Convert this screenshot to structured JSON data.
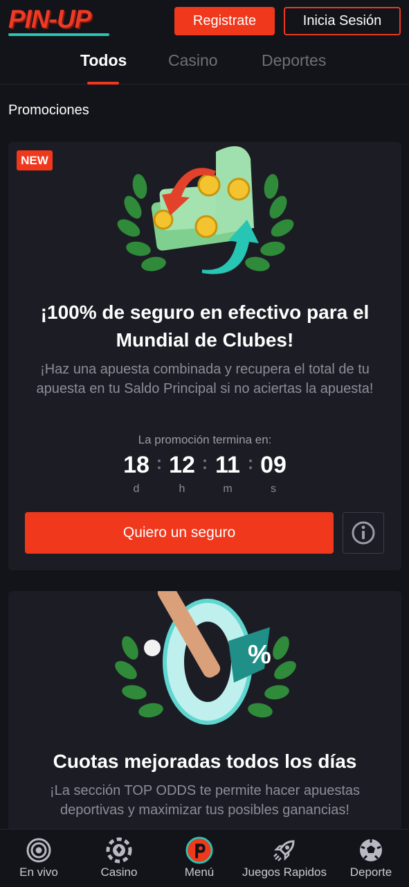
{
  "header": {
    "logo_text": "PIN-UP",
    "register_label": "Registrate",
    "login_label": "Inicia Sesión"
  },
  "tabs": [
    {
      "label": "Todos",
      "active": true
    },
    {
      "label": "Casino",
      "active": false
    },
    {
      "label": "Deportes",
      "active": false
    }
  ],
  "section_title": "Promociones",
  "promos": [
    {
      "badge": "NEW",
      "art_icon": "cashback-money-icon",
      "title_line1": "¡100% de seguro en efectivo para el",
      "title_line2": "Mundial de Clubes!",
      "desc_line1": "¡Haz una apuesta combinada y recupera el total de tu",
      "desc_line2": "apuesta en tu Saldo Principal si no aciertas la apuesta!",
      "countdown_label": "La promoción termina en:",
      "countdown": [
        {
          "value": "18",
          "unit": "d"
        },
        {
          "value": "12",
          "unit": "h"
        },
        {
          "value": "11",
          "unit": "m"
        },
        {
          "value": "09",
          "unit": "s"
        }
      ],
      "cta_label": "Quiero un seguro",
      "info_icon": "info-icon"
    },
    {
      "art_icon": "zero-percent-bat-icon",
      "title_line1": "Cuotas mejoradas todos los días",
      "desc_line1": "¡La sección TOP ODDS te permite hacer apuestas",
      "desc_line2": "deportivas y maximizar tus posibles ganancias!"
    }
  ],
  "bottom_nav": [
    {
      "label": "En vivo",
      "icon": "live-icon"
    },
    {
      "label": "Casino",
      "icon": "casino-chip-icon"
    },
    {
      "label": "Menú",
      "icon": "pinup-logo-icon"
    },
    {
      "label": "Juegos Rapidos",
      "icon": "rocket-icon"
    },
    {
      "label": "Deporte",
      "icon": "soccer-ball-icon"
    }
  ],
  "colors": {
    "accent": "#f0381d",
    "brand_teal": "#27c5b3",
    "background": "#131419",
    "card": "#1c1d24"
  }
}
